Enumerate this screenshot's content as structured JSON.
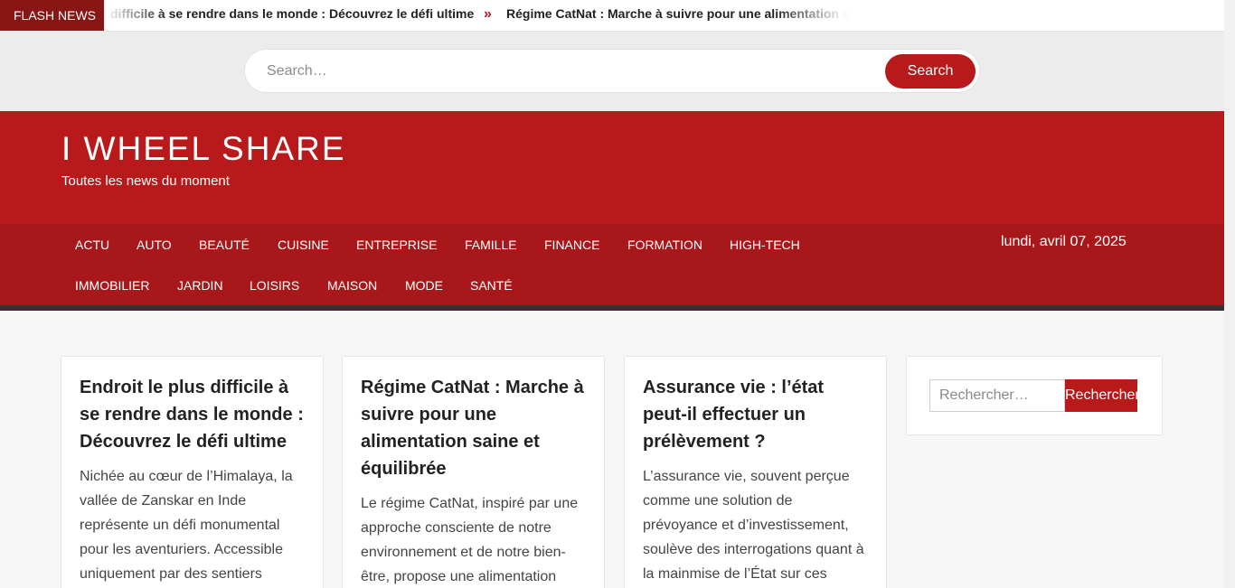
{
  "flash": {
    "label": "FLASH NEWS",
    "items": [
      "difficile à se rendre dans le monde : Découvrez le défi ultime",
      "Régime CatNat : Marche à suivre pour une alimentation saine"
    ],
    "separator": "»"
  },
  "top_search": {
    "placeholder": "Search…",
    "button_label": "Search"
  },
  "site": {
    "title": "I WHEEL SHARE",
    "tagline": "Toutes les news du moment"
  },
  "nav": {
    "items": [
      "ACTU",
      "AUTO",
      "BEAUTÉ",
      "CUISINE",
      "ENTREPRISE",
      "FAMILLE",
      "FINANCE",
      "FORMATION",
      "HIGH-TECH",
      "IMMOBILIER",
      "JARDIN",
      "LOISIRS",
      "MAISON",
      "MODE",
      "SANTÉ"
    ],
    "date": "lundi, avril 07, 2025"
  },
  "posts": [
    {
      "title": "Endroit le plus difficile à se rendre dans le monde : Découvrez le défi ultime",
      "excerpt": "Nichée au cœur de l’Himalaya, la vallée de Zanskar en Inde représente un défi monumental pour les aventuriers. Accessible uniquement par des sentiers"
    },
    {
      "title": "Régime CatNat : Marche à suivre pour une alimentation saine et équilibrée",
      "excerpt": "Le régime CatNat, inspiré par une approche consciente de notre environnement et de notre bien-être, propose une alimentation"
    },
    {
      "title": "Assurance vie : l’état peut-il effectuer un prélèvement ?",
      "excerpt": "L’assurance vie, souvent perçue comme une solution de prévoyance et d’investissement, soulève des interrogations quant à la mainmise de l’État sur ces"
    }
  ],
  "sidebar_search": {
    "placeholder": "Rechercher…",
    "button_label": "Rechercher"
  },
  "colors": {
    "brand_red": "#b8191b",
    "nav_red": "#a8181b",
    "flash_label": "#8a1515"
  }
}
